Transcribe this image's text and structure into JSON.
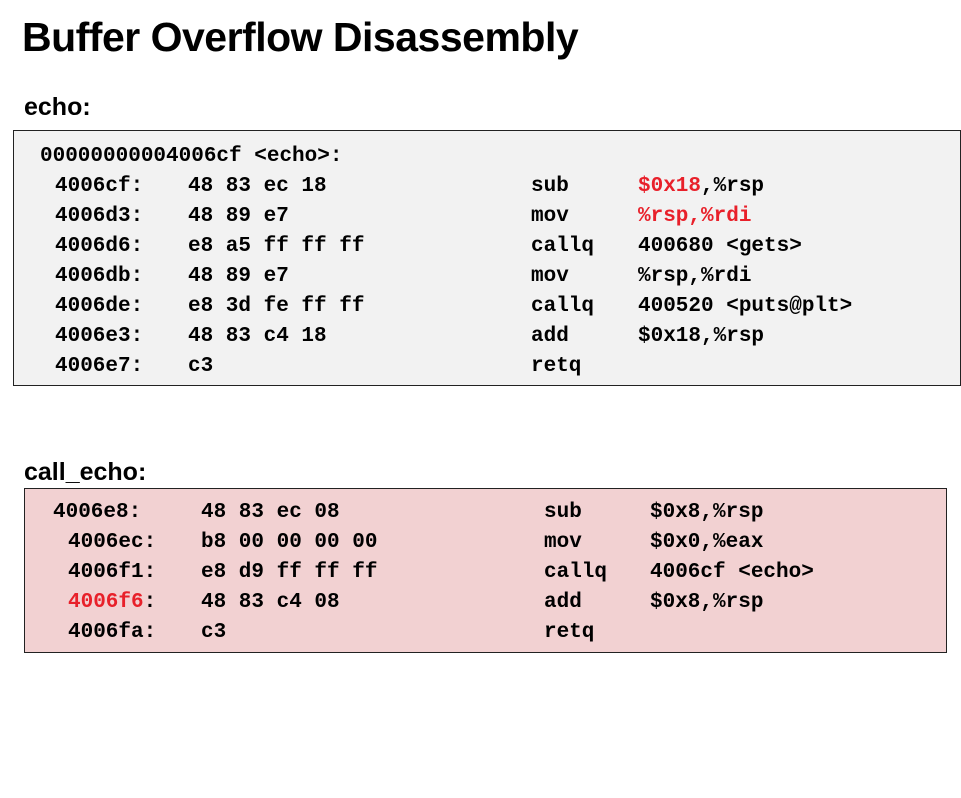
{
  "title": "Buffer Overflow Disassembly",
  "echo": {
    "label": "echo:",
    "header": "00000000004006cf <echo>:",
    "rows": [
      {
        "addr": "4006cf:",
        "bytes": "48 83 ec 18",
        "op": "sub",
        "args": ",%rsp",
        "args_red": "$0x18"
      },
      {
        "addr": "4006d3:",
        "bytes": "48 89 e7",
        "op": "mov",
        "args": "",
        "args_red": "%rsp,%rdi"
      },
      {
        "addr": "4006d6:",
        "bytes": "e8 a5 ff ff ff",
        "op": "callq",
        "args": "400680 <gets>",
        "args_red": ""
      },
      {
        "addr": "4006db:",
        "bytes": "48 89 e7",
        "op": "mov",
        "args": "%rsp,%rdi",
        "args_red": ""
      },
      {
        "addr": "4006de:",
        "bytes": "e8 3d fe ff ff",
        "op": "callq",
        "args": "400520 <puts@plt>",
        "args_red": ""
      },
      {
        "addr": "4006e3:",
        "bytes": "48 83 c4 18",
        "op": "add",
        "args": "$0x18,%rsp",
        "args_red": ""
      },
      {
        "addr": "4006e7:",
        "bytes": "c3",
        "op": "retq",
        "args": "",
        "args_red": ""
      }
    ]
  },
  "call_echo": {
    "label": "call_echo:",
    "rows": [
      {
        "addr": "4006e8:",
        "addr_red": "",
        "addr_suffix": "",
        "bytes": "48 83 ec 08",
        "op": "sub",
        "args": "$0x8,%rsp"
      },
      {
        "addr": "4006ec:",
        "addr_red": "",
        "addr_suffix": "",
        "bytes": "b8 00 00 00 00",
        "op": "mov",
        "args": "$0x0,%eax"
      },
      {
        "addr": "4006f1:",
        "addr_red": "",
        "addr_suffix": "",
        "bytes": "e8 d9 ff ff ff",
        "op": "callq",
        "args": "4006cf <echo>"
      },
      {
        "addr": "",
        "addr_red": "4006f6",
        "addr_suffix": ":",
        "bytes": "48 83 c4 08",
        "op": "add",
        "args": "$0x8,%rsp"
      },
      {
        "addr": "4006fa:",
        "addr_red": "",
        "addr_suffix": "",
        "bytes": "c3",
        "op": "retq",
        "args": ""
      }
    ]
  },
  "colors": {
    "highlight": "#e8202a",
    "echo_bg": "#f2f2f2",
    "call_echo_bg": "#f2d1d2"
  }
}
